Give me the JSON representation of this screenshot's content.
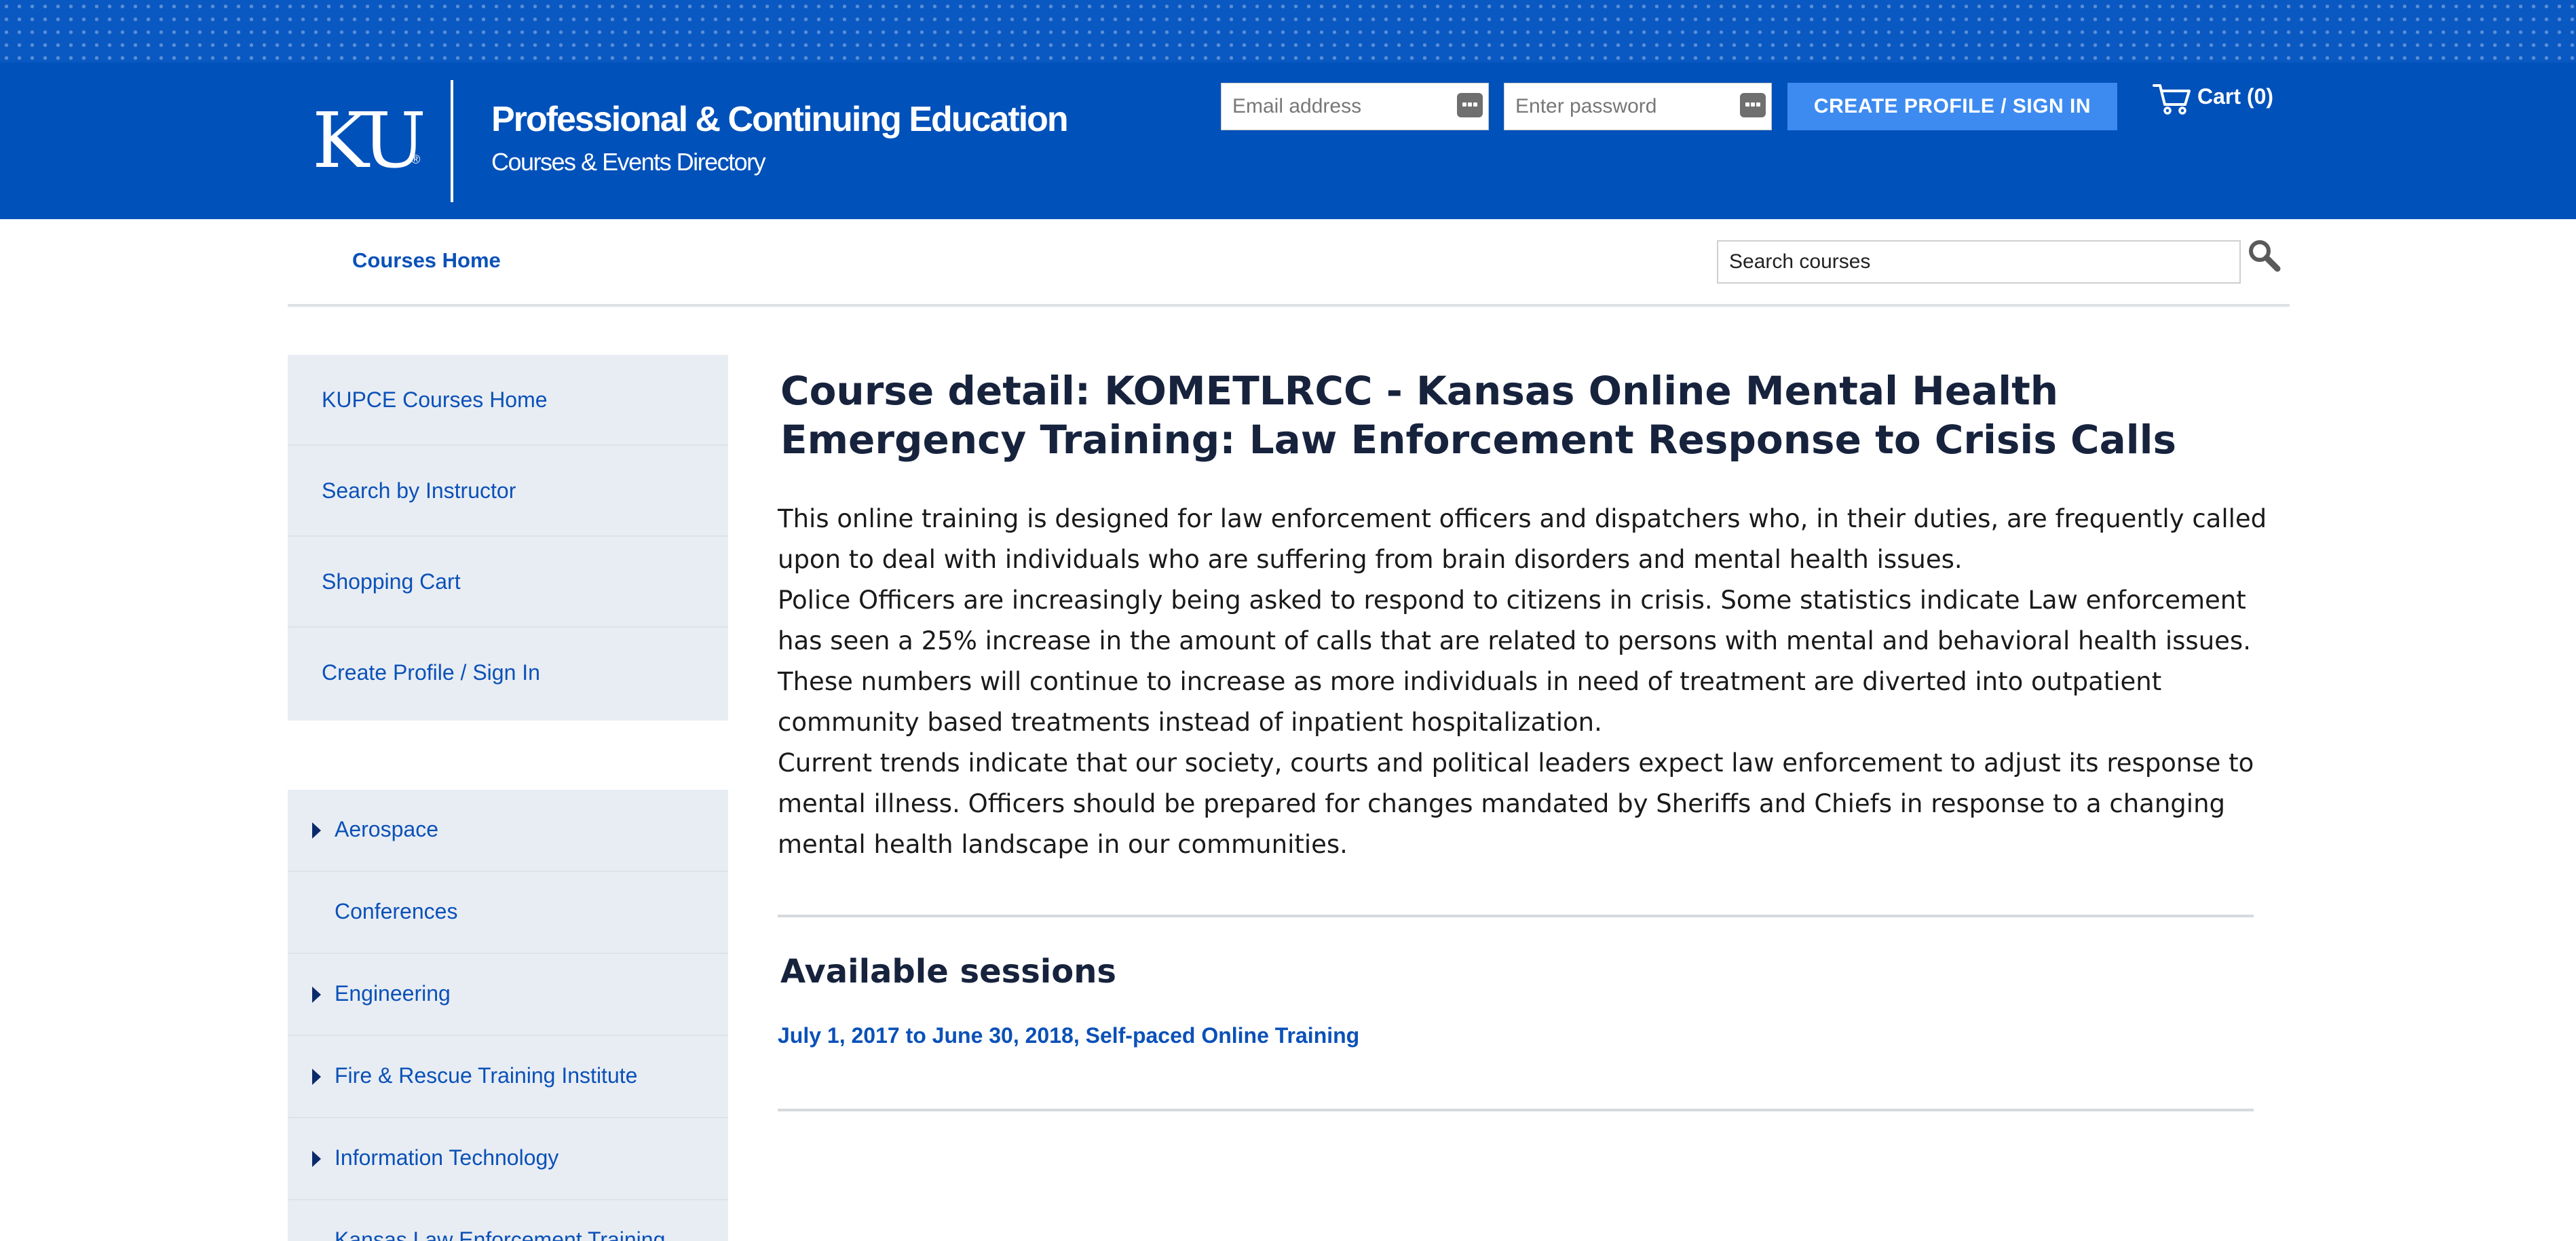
{
  "header": {
    "logo_text": "KU",
    "logo_reg": "®",
    "title": "Professional & Continuing Education",
    "subtitle": "Courses & Events Directory",
    "email_placeholder": "Email address",
    "password_placeholder": "Enter password",
    "signin_label": "CREATE PROFILE / SIGN IN",
    "cart_label": "Cart (0)",
    "cart_icon": "shopping-cart-icon",
    "field_icon": "keyboard-icon",
    "brand_color": "#0051ba",
    "button_color": "#3d8bf0"
  },
  "nav": {
    "courses_home": "Courses Home",
    "search_placeholder": "Search courses",
    "search_icon": "magnifier-icon"
  },
  "sidebar": {
    "links": [
      "KUPCE Courses Home",
      "Search by Instructor",
      "Shopping Cart",
      "Create Profile / Sign In"
    ],
    "categories": [
      {
        "label": "Aerospace",
        "expandable": true
      },
      {
        "label": "Conferences",
        "expandable": false
      },
      {
        "label": "Engineering",
        "expandable": true
      },
      {
        "label": "Fire & Rescue Training Institute",
        "expandable": true
      },
      {
        "label": "Information Technology",
        "expandable": true
      },
      {
        "label": "Kansas Law Enforcement Training",
        "expandable": false
      }
    ]
  },
  "main": {
    "title": "Course detail: KOMETLRCC - Kansas Online Mental Health Emergency Training: Law Enforcement Response to Crisis Calls",
    "paragraphs": [
      "This online training is designed for law enforcement officers and dispatchers who, in their duties, are frequently called upon to deal with individuals who are suffering from brain disorders and mental health issues.",
      "Police Officers are increasingly being asked to respond to citizens in crisis. Some statistics indicate Law enforcement has seen a 25% increase in the amount of calls that are related to persons with mental and behavioral health issues. These numbers will continue to increase as more individuals in need of treatment are diverted into outpatient community based treatments instead of inpatient hospitalization.",
      "Current trends indicate that our society, courts and political leaders expect law enforcement to adjust its response to mental illness. Officers should be prepared for changes mandated by Sheriffs and Chiefs in response to a changing mental health landscape in our communities."
    ],
    "sessions_heading": "Available sessions",
    "session_link": "July 1, 2017 to June 30, 2018, Self-paced Online Training"
  }
}
